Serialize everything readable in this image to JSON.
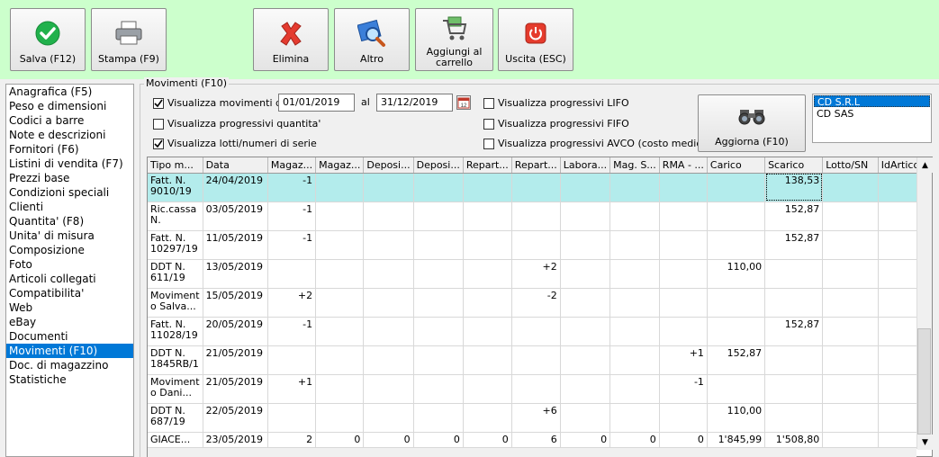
{
  "toolbar": {
    "buttons": [
      {
        "label": "Salva (F12)",
        "icon": "check-icon"
      },
      {
        "label": "Stampa (F9)",
        "icon": "printer-icon"
      },
      {
        "label": "Elimina",
        "icon": "delete-x-icon"
      },
      {
        "label": "Altro",
        "icon": "magnifier-icon"
      },
      {
        "label": "Aggiungi al carrello",
        "icon": "cart-icon"
      },
      {
        "label": "Uscita (ESC)",
        "icon": "power-icon"
      }
    ],
    "colors": {
      "background": "#ccffcc",
      "check": "#21b14c",
      "delete": "#e43b2f",
      "exit": "#e53b2c"
    }
  },
  "sidebar": {
    "items": [
      "Anagrafica (F5)",
      "Peso e dimensioni",
      "Codici a barre",
      "Note e descrizioni",
      "Fornitori (F6)",
      "Listini di vendita (F7)",
      "Prezzi base",
      "Condizioni speciali",
      "Clienti",
      "Quantita' (F8)",
      "Unita' di misura",
      "Composizione",
      "Foto",
      "Articoli collegati",
      "Compatibilita'",
      "Web",
      "eBay",
      "Documenti",
      "Movimenti (F10)",
      "Doc. di magazzino",
      "Statistiche"
    ],
    "selected": "Movimenti (F10)",
    "selected_color": "#0078d7"
  },
  "movimenti": {
    "title": "Movimenti (F10)",
    "show_from_label": "Visualizza movimenti dal",
    "date_from": "01/01/2019",
    "to_label": "al",
    "date_to": "31/12/2019",
    "opt_qty": "Visualizza progressivi quantita'",
    "opt_lots": "Visualizza lotti/numeri di serie",
    "opt_lifo": "Visualizza progressivi LIFO",
    "opt_fifo": "Visualizza progressivi FIFO",
    "opt_avco": "Visualizza progressivi AVCO (costo medio)",
    "refresh_label": "Aggiorna (F10)",
    "companies": [
      "CD S.R.L",
      "CD SAS"
    ],
    "selected_company": "CD S.R.L"
  },
  "grid": {
    "columns": [
      "Tipo m...",
      "Data",
      "Magaz...",
      "Magaz...",
      "Deposi...",
      "Deposi...",
      "Repart...",
      "Repart...",
      "Labora...",
      "Mag. S...",
      "RMA - ...",
      "Carico",
      "Scarico",
      "Lotto/SN",
      "IdArticolo"
    ],
    "rows": [
      [
        "Fatt. N. 9010/19",
        "24/04/2019",
        "-1",
        "",
        "",
        "",
        "",
        "",
        "",
        "",
        "",
        "",
        "138,53",
        "",
        ""
      ],
      [
        "Ric.cassa N.",
        "03/05/2019",
        "-1",
        "",
        "",
        "",
        "",
        "",
        "",
        "",
        "",
        "",
        "152,87",
        "",
        ""
      ],
      [
        "Fatt. N. 10297/19",
        "11/05/2019",
        "-1",
        "",
        "",
        "",
        "",
        "",
        "",
        "",
        "",
        "",
        "152,87",
        "",
        ""
      ],
      [
        "DDT N. 611/19",
        "13/05/2019",
        "",
        "",
        "",
        "",
        "",
        "+2",
        "",
        "",
        "",
        "110,00",
        "",
        "",
        ""
      ],
      [
        "Moviment o Salva...",
        "15/05/2019",
        "+2",
        "",
        "",
        "",
        "",
        "-2",
        "",
        "",
        "",
        "",
        "",
        "",
        ""
      ],
      [
        "Fatt. N. 11028/19",
        "20/05/2019",
        "-1",
        "",
        "",
        "",
        "",
        "",
        "",
        "",
        "",
        "",
        "152,87",
        "",
        ""
      ],
      [
        "DDT N. 1845RB/1",
        "21/05/2019",
        "",
        "",
        "",
        "",
        "",
        "",
        "",
        "",
        "+1",
        "152,87",
        "",
        "",
        ""
      ],
      [
        "Moviment o Dani...",
        "21/05/2019",
        "+1",
        "",
        "",
        "",
        "",
        "",
        "",
        "",
        "-1",
        "",
        "",
        "",
        ""
      ],
      [
        "DDT N. 687/19",
        "22/05/2019",
        "",
        "",
        "",
        "",
        "",
        "+6",
        "",
        "",
        "",
        "110,00",
        "",
        "",
        ""
      ],
      [
        "GIACE...",
        "23/05/2019",
        "2",
        "0",
        "0",
        "0",
        "0",
        "6",
        "0",
        "0",
        "0",
        "1'845,99",
        "1'508,80",
        "",
        ""
      ]
    ],
    "selected_row_color": "#b3ecec"
  }
}
